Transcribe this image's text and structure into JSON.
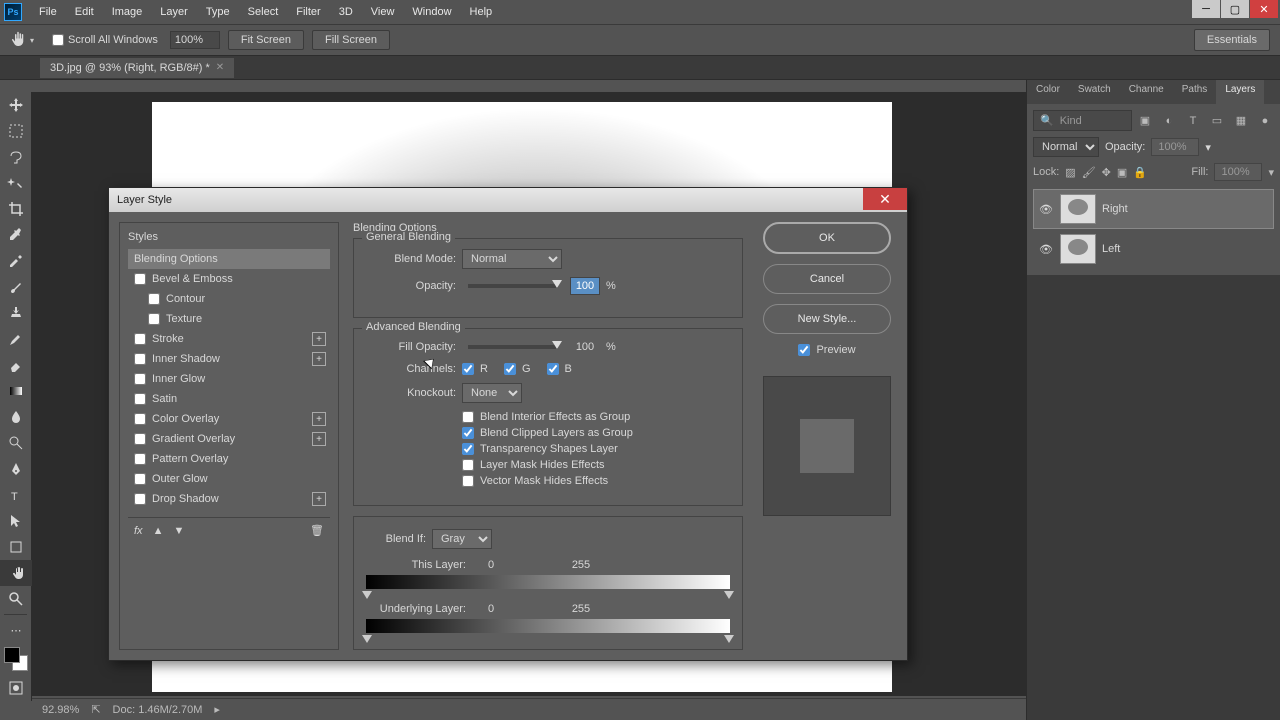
{
  "app": {
    "icon_text": "Ps"
  },
  "menu": [
    "File",
    "Edit",
    "Image",
    "Layer",
    "Type",
    "Select",
    "Filter",
    "3D",
    "View",
    "Window",
    "Help"
  ],
  "options": {
    "scroll_all": "Scroll All Windows",
    "zoom": "100%",
    "fit_screen": "Fit Screen",
    "fill_screen": "Fill Screen",
    "essentials": "Essentials"
  },
  "document": {
    "tab_title": "3D.jpg @ 93% (Right, RGB/8#) *"
  },
  "panels": {
    "tabs": [
      "Color",
      "Swatch",
      "Channe",
      "Paths",
      "Layers"
    ],
    "kind_placeholder": "Kind",
    "mode": "Normal",
    "opacity_label": "Opacity:",
    "opacity_value": "100%",
    "lock_label": "Lock:",
    "fill_label": "Fill:",
    "fill_value": "100%",
    "layers": [
      {
        "name": "Right",
        "selected": true
      },
      {
        "name": "Left",
        "selected": false
      }
    ]
  },
  "status": {
    "zoom": "92.98%",
    "doc": "Doc: 1.46M/2.70M"
  },
  "dialog": {
    "title": "Layer Style",
    "styles_header": "Styles",
    "styles_list": [
      {
        "label": "Blending Options",
        "selected": true
      },
      {
        "label": "Bevel & Emboss",
        "checkbox": true
      },
      {
        "label": "Contour",
        "checkbox": true,
        "indented": true
      },
      {
        "label": "Texture",
        "checkbox": true,
        "indented": true
      },
      {
        "label": "Stroke",
        "checkbox": true,
        "add": true
      },
      {
        "label": "Inner Shadow",
        "checkbox": true,
        "add": true
      },
      {
        "label": "Inner Glow",
        "checkbox": true
      },
      {
        "label": "Satin",
        "checkbox": true
      },
      {
        "label": "Color Overlay",
        "checkbox": true,
        "add": true
      },
      {
        "label": "Gradient Overlay",
        "checkbox": true,
        "add": true
      },
      {
        "label": "Pattern Overlay",
        "checkbox": true
      },
      {
        "label": "Outer Glow",
        "checkbox": true
      },
      {
        "label": "Drop Shadow",
        "checkbox": true,
        "add": true
      }
    ],
    "section_title": "Blending Options",
    "general_blending": "General Blending",
    "blend_mode_label": "Blend Mode:",
    "blend_mode_value": "Normal",
    "opacity_label": "Opacity:",
    "opacity_value": "100",
    "percent": "%",
    "advanced_blending": "Advanced Blending",
    "fill_opacity_label": "Fill Opacity:",
    "fill_opacity_value": "100",
    "channels_label": "Channels:",
    "ch_r": "R",
    "ch_g": "G",
    "ch_b": "B",
    "knockout_label": "Knockout:",
    "knockout_value": "None",
    "chk_interior": "Blend Interior Effects as Group",
    "chk_clipped": "Blend Clipped Layers as Group",
    "chk_transparency": "Transparency Shapes Layer",
    "chk_layermask": "Layer Mask Hides Effects",
    "chk_vectormask": "Vector Mask Hides Effects",
    "blend_if_label": "Blend If:",
    "blend_if_value": "Gray",
    "this_layer_label": "This Layer:",
    "this_layer_min": "0",
    "this_layer_max": "255",
    "underlying_label": "Underlying Layer:",
    "underlying_min": "0",
    "underlying_max": "255",
    "btn_ok": "OK",
    "btn_cancel": "Cancel",
    "btn_new_style": "New Style...",
    "preview_label": "Preview"
  }
}
